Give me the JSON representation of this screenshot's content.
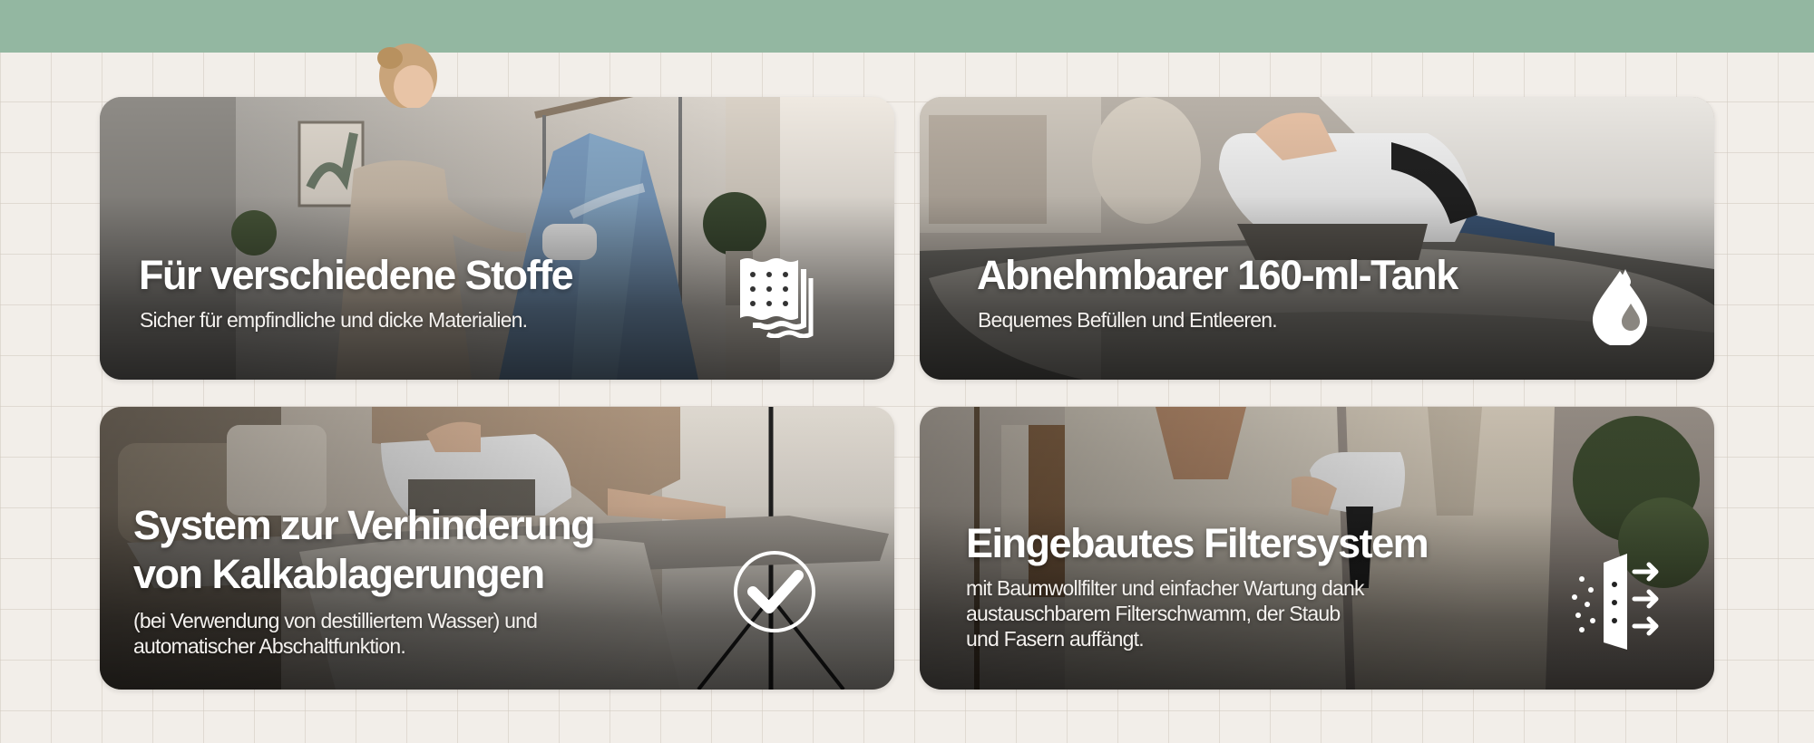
{
  "colors": {
    "top_band": "#93b7a1",
    "background": "#f2eee9",
    "text": "#ffffff"
  },
  "cards": [
    {
      "title": "Für verschiedene Stoffe",
      "subtitle_lines": [
        "Sicher für empfindliche und dicke Materialien."
      ],
      "icon": "fabric-swatch-icon"
    },
    {
      "title": "Abnehmbarer 160-ml-Tank",
      "subtitle_lines": [
        "Bequemes Befüllen und Entleeren."
      ],
      "icon": "water-drops-icon"
    },
    {
      "title_lines": [
        "System zur Verhinderung",
        "von Kalkablagerungen"
      ],
      "subtitle_lines": [
        "(bei Verwendung von destilliertem Wasser) und",
        "automatischer Abschaltfunktion."
      ],
      "icon": "checkmark-circle-icon"
    },
    {
      "title": "Eingebautes Filtersystem",
      "subtitle_lines": [
        "mit Baumwollfilter und einfacher Wartung dank",
        "austauschbarem Filterschwamm, der Staub",
        "und Fasern auffängt."
      ],
      "icon": "filter-airflow-icon"
    }
  ]
}
